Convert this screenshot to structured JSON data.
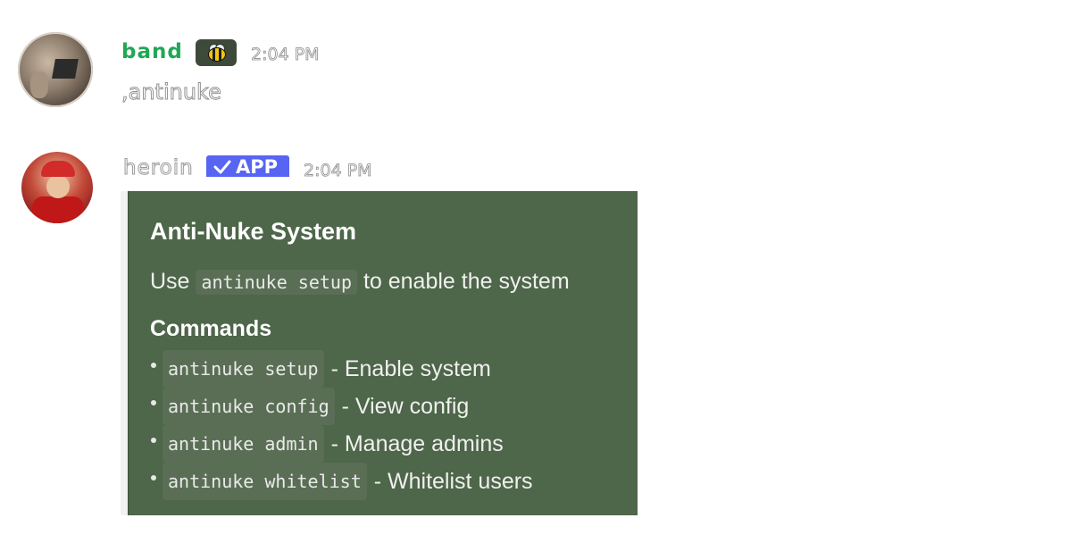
{
  "messages": [
    {
      "username": "band",
      "role_emoji": "bee-emoji",
      "timestamp": "2:04 PM",
      "content": ",antinuke"
    },
    {
      "username": "heroin",
      "badge": "APP",
      "timestamp": "2:04 PM",
      "embed": {
        "color": "#4e6649",
        "title": "Anti-Nuke System",
        "desc_prefix": "Use",
        "desc_code": "antinuke setup",
        "desc_suffix": "to enable the system",
        "section_title": "Commands",
        "commands": [
          {
            "code": "antinuke setup",
            "desc": "- Enable system"
          },
          {
            "code": "antinuke config",
            "desc": "- View config"
          },
          {
            "code": "antinuke admin",
            "desc": "- Manage admins"
          },
          {
            "code": "antinuke whitelist",
            "desc": "- Whitelist users"
          }
        ]
      }
    }
  ],
  "colors": {
    "username_band": "#1fa855",
    "app_badge": "#5865f2",
    "embed_bg": "#4e6649"
  }
}
